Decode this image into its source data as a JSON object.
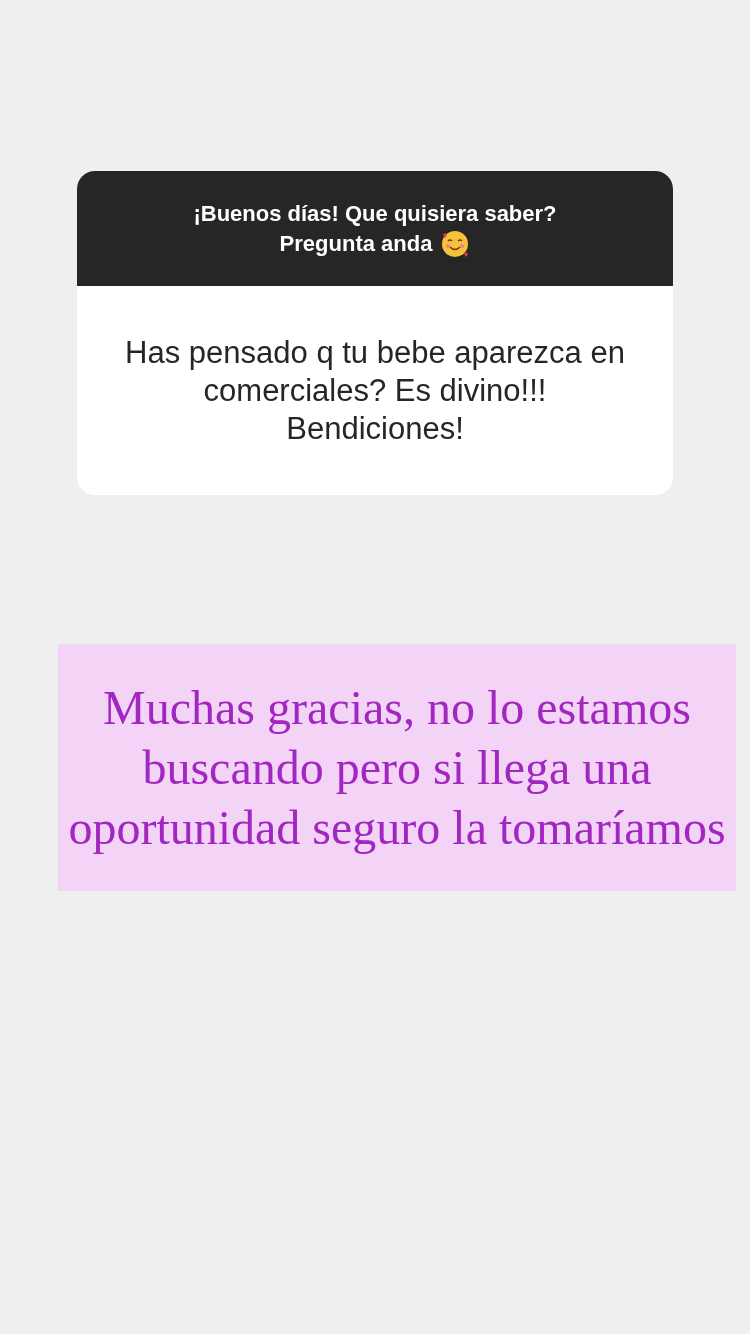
{
  "question_card": {
    "prompt_lines": [
      "¡Buenos días! Que quisiera saber?",
      "Pregunta anda"
    ],
    "answer": "Has pensado q tu bebe aparezca en comerciales? Es divino!!! Bendiciones!"
  },
  "reply_text": "Muchas gracias, no lo estamos buscando pero si llega una oportunidad seguro la tomaríamos"
}
